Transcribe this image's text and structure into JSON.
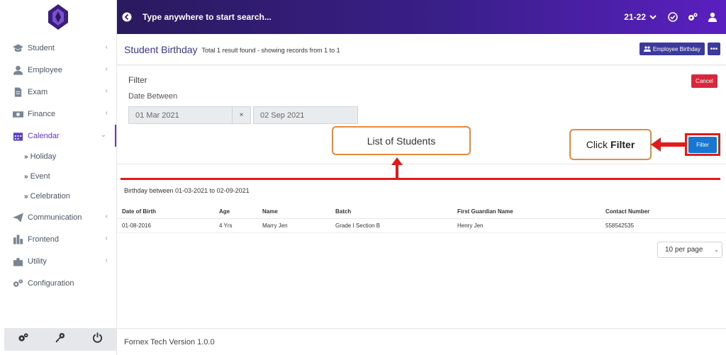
{
  "sidebar": {
    "items": [
      {
        "label": "Student",
        "icon": "graduation-cap-icon"
      },
      {
        "label": "Employee",
        "icon": "user-icon"
      },
      {
        "label": "Exam",
        "icon": "file-icon"
      },
      {
        "label": "Finance",
        "icon": "money-icon"
      },
      {
        "label": "Calendar",
        "icon": "calendar-icon"
      },
      {
        "label": "Communication",
        "icon": "paper-plane-icon"
      },
      {
        "label": "Frontend",
        "icon": "building-icon"
      },
      {
        "label": "Utility",
        "icon": "puzzle-icon"
      },
      {
        "label": "Configuration",
        "icon": "cogs-icon"
      }
    ],
    "calendar_sub": [
      "Holiday",
      "Event",
      "Celebration"
    ]
  },
  "header": {
    "search_placeholder": "Type anywhere to start search...",
    "academic_year": "21-22"
  },
  "page": {
    "title": "Student Birthday",
    "subtitle": "Total 1 result found - showing records from 1 to 1",
    "employee_birthday_label": "Employee Birthday"
  },
  "filter": {
    "title": "Filter",
    "date_label": "Date Between",
    "date_from": "01 Mar 2021",
    "date_to": "02 Sep 2021",
    "clear_symbol": "×",
    "cancel_label": "Cancel",
    "filter_label": "Filter"
  },
  "annotations": {
    "list_callout": "List of Students",
    "click_prefix": "Click",
    "click_bold": "Filter"
  },
  "results": {
    "range_text": "Birthday between 01-03-2021 to 02-09-2021",
    "columns": [
      "Date of Birth",
      "Age",
      "Name",
      "Batch",
      "First Guardian Name",
      "Contact Number"
    ],
    "rows": [
      [
        "01-08-2016",
        "4 Yrs",
        "Marry Jen",
        "Grade I Section B",
        "Henry Jen",
        "558542535"
      ]
    ],
    "per_page": "10 per page"
  },
  "footer": {
    "version": "Fornex Tech Version 1.0.0"
  },
  "colors": {
    "accent": "#3d3a9e",
    "header_gradient_start": "#2a1a5e",
    "header_gradient_end": "#5a1fc0",
    "cancel": "#d9263a",
    "filter": "#1976d2",
    "annotation_red": "#e11a1a",
    "annotation_orange": "#e8893a"
  }
}
